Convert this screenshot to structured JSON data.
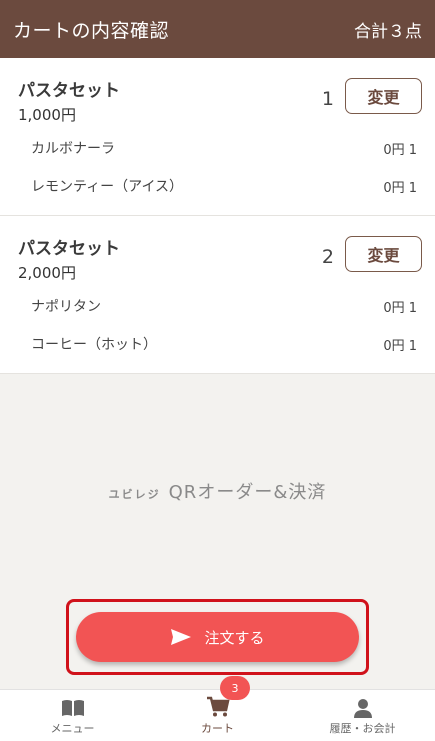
{
  "header": {
    "title": "カートの内容確認",
    "total": "合計３点"
  },
  "items": [
    {
      "name": "パスタセット",
      "price": "1,000円",
      "quantity": "1",
      "change_label": "変更",
      "options": [
        {
          "name": "カルボナーラ",
          "price": "0円 1"
        },
        {
          "name": "レモンティー（アイス）",
          "price": "0円 1"
        }
      ]
    },
    {
      "name": "パスタセット",
      "price": "2,000円",
      "quantity": "2",
      "change_label": "変更",
      "options": [
        {
          "name": "ナポリタン",
          "price": "0円 1"
        },
        {
          "name": "コーヒー（ホット）",
          "price": "0円 1"
        }
      ]
    }
  ],
  "brand": {
    "prefix": "ユビレジ",
    "name": "QRオーダー&決済"
  },
  "order_button": {
    "label": "注文する",
    "icon": "send-icon"
  },
  "tabs": [
    {
      "label": "メニュー",
      "icon": "book-icon"
    },
    {
      "label": "カート",
      "icon": "cart-icon",
      "badge": "3"
    },
    {
      "label": "履歴・お会計",
      "icon": "person-icon"
    }
  ],
  "colors": {
    "header": "#6b4a3e",
    "accent": "#f25454",
    "highlight": "#d0121b"
  }
}
